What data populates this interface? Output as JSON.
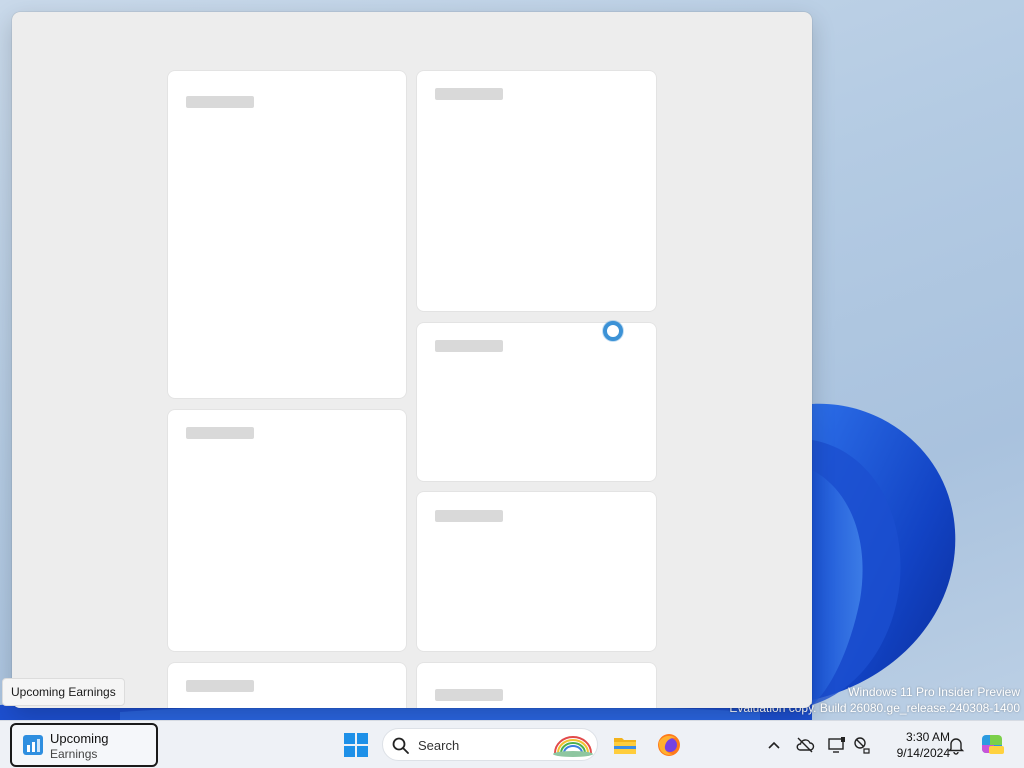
{
  "panel": {
    "cards": [
      {
        "id": "card-1"
      },
      {
        "id": "card-2"
      },
      {
        "id": "card-3"
      },
      {
        "id": "card-4"
      },
      {
        "id": "card-5"
      },
      {
        "id": "card-6"
      },
      {
        "id": "card-7"
      }
    ],
    "loading": true
  },
  "tooltip": {
    "text": "Upcoming Earnings"
  },
  "taskbar": {
    "widget": {
      "line1": "Upcoming",
      "line2": "Earnings"
    },
    "search": {
      "placeholder": "Search"
    },
    "apps": [
      "start-icon",
      "search-icon",
      "file-explorer-icon",
      "firefox-icon"
    ],
    "tray": [
      "chevron-up-icon",
      "cloud-offline-icon",
      "display-icon",
      "network-icon",
      "notification-bell-icon",
      "copilot-pre-icon"
    ],
    "clock": {
      "time": "3:30 AM",
      "date": "9/14/2024"
    }
  },
  "watermark": {
    "line1": "Windows 11 Pro Insider Preview",
    "line2": "Evaluation copy. Build 26080.ge_release.240308-1400"
  },
  "colors": {
    "accent": "#3c92d6",
    "panel_bg": "#ededed",
    "taskbar_bg": "#eef1f6",
    "placeholder": "#d9d9d9"
  }
}
